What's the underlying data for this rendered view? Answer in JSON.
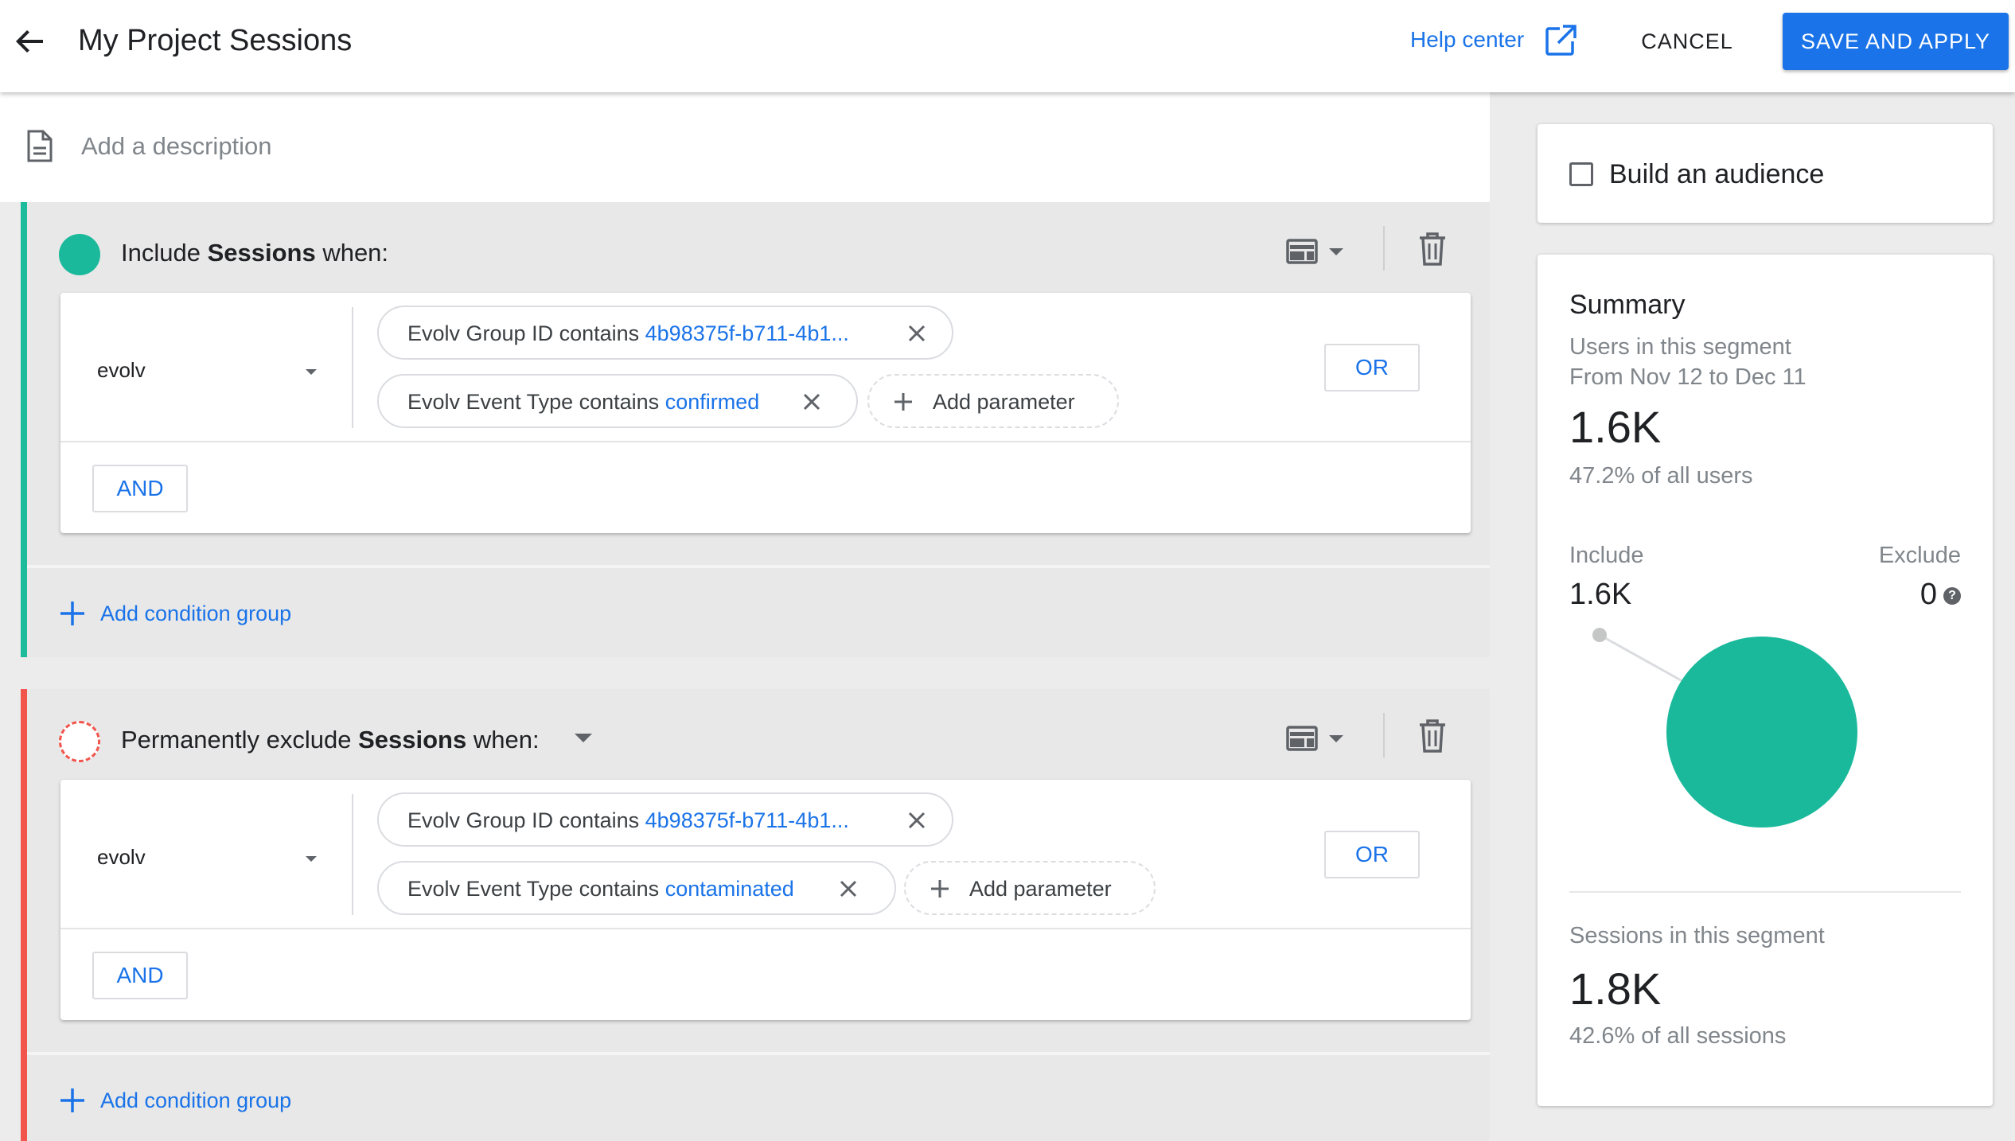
{
  "header": {
    "title": "My Project Sessions",
    "help_label": "Help center",
    "cancel_label": "CANCEL",
    "save_label": "SAVE AND APPLY"
  },
  "description": {
    "placeholder": "Add a description"
  },
  "include_group": {
    "label_pre": "Include ",
    "label_bold": "Sessions",
    "label_post": " when:",
    "color": "#1cbb9c",
    "dimension": "evolv",
    "chips": [
      {
        "field": "Evolv Group ID contains ",
        "value": "4b98375f-b711-4b1..."
      },
      {
        "field": "Evolv Event Type contains ",
        "value": "confirmed"
      }
    ],
    "add_parameter": "Add parameter",
    "or_label": "OR",
    "and_label": "AND",
    "add_condition_group": "Add condition group"
  },
  "exclude_group": {
    "label_pre": "Permanently exclude ",
    "label_bold": "Sessions",
    "label_post": " when:",
    "color": "#f1554c",
    "dimension": "evolv",
    "chips": [
      {
        "field": "Evolv Group ID contains ",
        "value": "4b98375f-b711-4b1..."
      },
      {
        "field": "Evolv Event Type contains ",
        "value": "contaminated"
      }
    ],
    "add_parameter": "Add parameter",
    "or_label": "OR",
    "and_label": "AND",
    "add_condition_group": "Add condition group"
  },
  "audience": {
    "label": "Build an audience",
    "checked": false
  },
  "summary": {
    "title": "Summary",
    "users_label": "Users in this segment",
    "date_range": "From Nov 12 to Dec 11",
    "users_value": "1.6K",
    "users_pct": "47.2% of all users",
    "include_label": "Include",
    "include_value": "1.6K",
    "exclude_label": "Exclude",
    "exclude_value": "0",
    "help_glyph": "?",
    "sessions_label": "Sessions in this segment",
    "sessions_value": "1.8K",
    "sessions_pct": "42.6% of all sessions",
    "accent_color": "#1ab99b"
  }
}
